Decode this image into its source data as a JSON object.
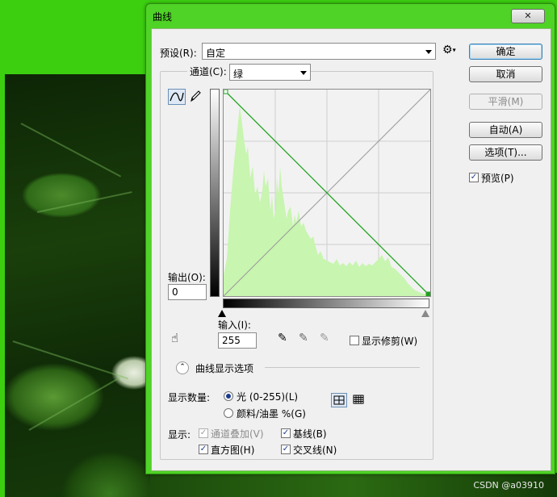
{
  "window": {
    "title": "曲线",
    "close_label": "✕"
  },
  "preset": {
    "label": "预设(R):",
    "value": "自定",
    "options_icon": "gear-icon"
  },
  "buttons": {
    "ok": "确定",
    "cancel": "取消",
    "smooth": "平滑(M)",
    "auto": "自动(A)",
    "options": "选项(T)..."
  },
  "preview": {
    "label": "预览(P)",
    "checked": true
  },
  "channel": {
    "label": "通道(C):",
    "value": "绿"
  },
  "output": {
    "label": "输出(O):",
    "value": "0"
  },
  "input": {
    "label": "输入(I):",
    "value": "255"
  },
  "show_clipping": {
    "label": "显示修剪(W)",
    "checked": false
  },
  "curve_options": {
    "label": "曲线显示选项"
  },
  "show_amount": {
    "label": "显示数量:",
    "light": "光 (0-255)(L)",
    "pigment": "颜料/油墨 %(G)",
    "selected": "light"
  },
  "show": {
    "label": "显示:",
    "channel_overlay": "通道叠加(V)",
    "baseline": "基线(B)",
    "histogram": "直方图(H)",
    "intersection": "交叉线(N)"
  },
  "colors": {
    "accent": "#3ccf10",
    "histogram": "#c8f5b0",
    "curve": "#1fa31f"
  },
  "watermark": "CSDN @a03910"
}
